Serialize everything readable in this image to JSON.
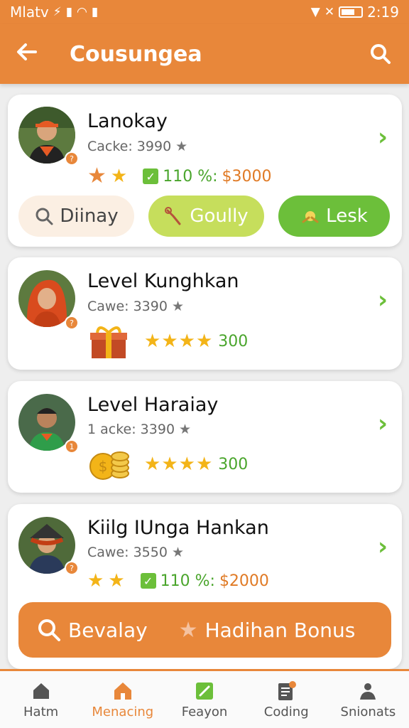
{
  "status_bar": {
    "carrier": "Mlatv",
    "time": "2:19"
  },
  "header": {
    "title": "Cousungea"
  },
  "cards": [
    {
      "name": "Lanokay",
      "meta": "Cacke: 3990",
      "badge": "?",
      "percent": "110 %:",
      "amount": "$3000",
      "buttons": [
        "Diinay",
        "Goully",
        "Lesk"
      ]
    },
    {
      "name": "Level Kunghkan",
      "meta": "Cawe: 3390",
      "badge": "?",
      "reward": "300"
    },
    {
      "name": "Level Haraiay",
      "meta": "1 acke: 3390",
      "badge": "1",
      "reward": "300"
    },
    {
      "name": "Kiilg IUnga Hankan",
      "meta": "Cawe: 3550",
      "badge": "?",
      "percent": "110 %:",
      "amount": "$2000",
      "action_left": "Bevalay",
      "action_right": "Hadihan Bonus"
    }
  ],
  "bottom_nav": [
    {
      "label": "Hatm",
      "icon": "home-icon"
    },
    {
      "label": "Menacing",
      "icon": "house-icon",
      "active": true
    },
    {
      "label": "Feayon",
      "icon": "edit-icon"
    },
    {
      "label": "Coding",
      "icon": "document-icon"
    },
    {
      "label": "Snionats",
      "icon": "people-icon"
    }
  ],
  "colors": {
    "accent": "#e8873a",
    "green": "#6cbf3a",
    "lime": "#c6de5c",
    "star": "#f3b418"
  }
}
